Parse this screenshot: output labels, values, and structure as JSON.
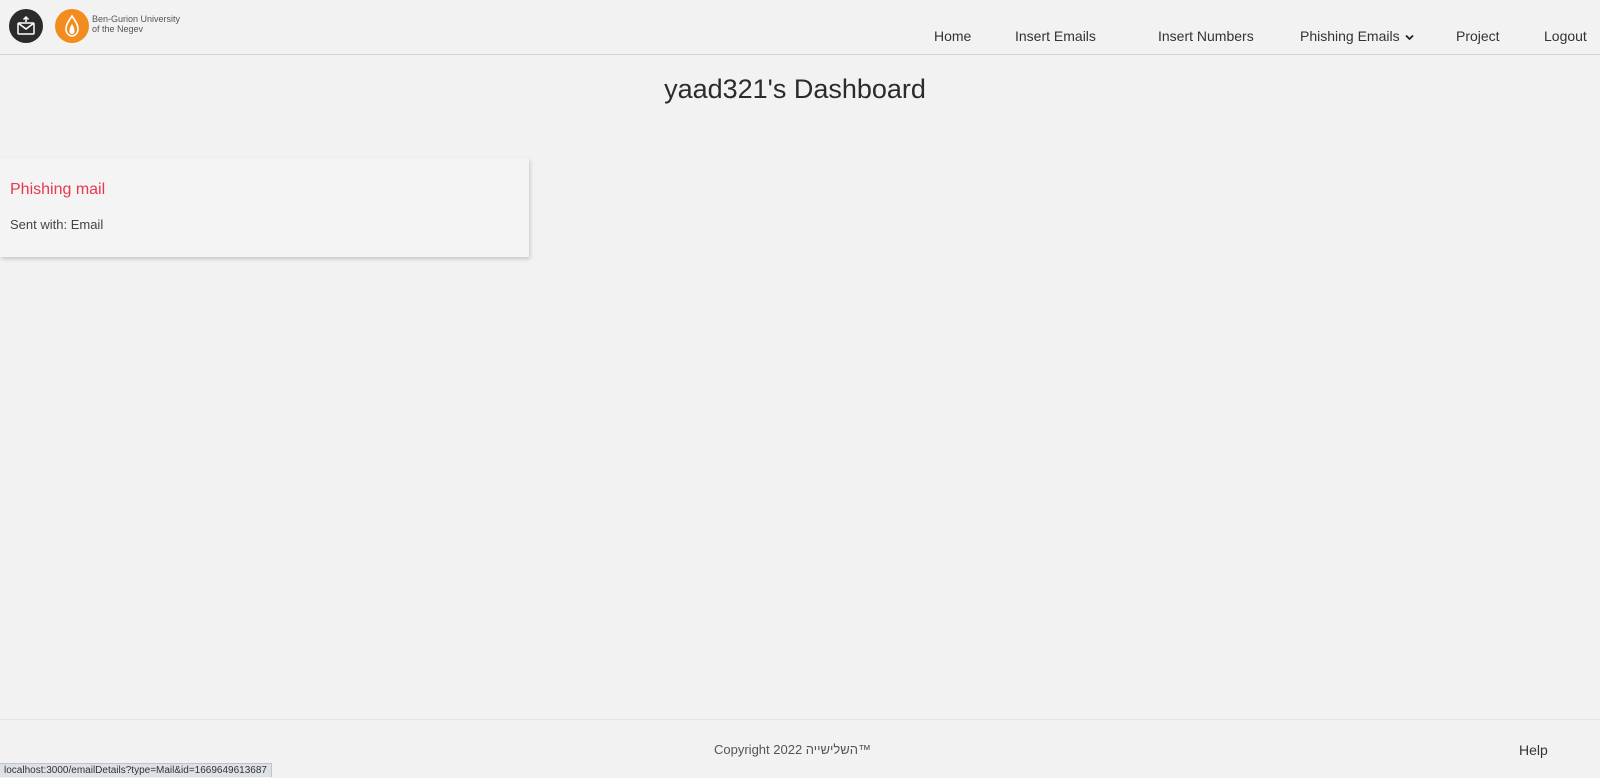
{
  "header": {
    "university_line1": "Ben-Gurion University",
    "university_line2": "of the Negev",
    "nav": [
      {
        "label": "Home"
      },
      {
        "label": "Insert Emails"
      },
      {
        "label": "Insert Numbers"
      },
      {
        "label": "Phishing Emails",
        "has_dropdown": true
      },
      {
        "label": "Project"
      },
      {
        "label": "Logout"
      }
    ]
  },
  "main": {
    "title": "yaad321's Dashboard",
    "cards": [
      {
        "title": "Phishing mail",
        "subtitle": "Sent with: Email"
      }
    ]
  },
  "footer": {
    "copyright": "Copyright 2022 השלישייה™",
    "help": "Help"
  },
  "status_bar": {
    "url": "localhost:3000/emailDetails?type=Mail&id=1669649613687"
  },
  "colors": {
    "background": "#f2f2f2",
    "card_title": "#e8384f",
    "bgu_orange": "#f28c1e"
  },
  "icons": {
    "app_logo": "mail-upload-icon",
    "university_logo": "bgu-flame-icon",
    "dropdown": "chevron-down-icon"
  }
}
